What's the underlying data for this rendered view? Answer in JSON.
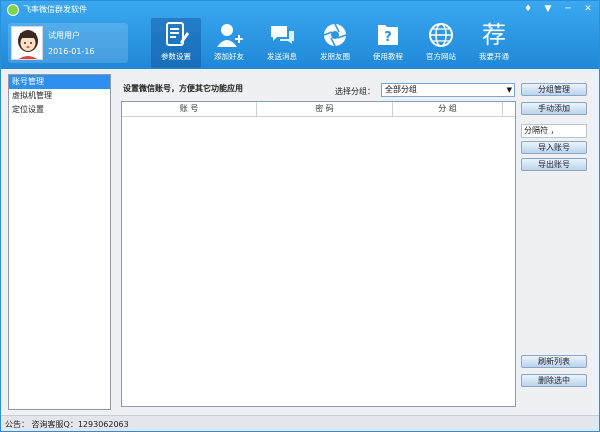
{
  "app": {
    "title": "飞率微信群发软件"
  },
  "window_controls": [
    "♦",
    "▼",
    "─",
    "✕"
  ],
  "user": {
    "name": "试用用户",
    "date": "2016-01-16"
  },
  "nav": [
    {
      "label": "参数设置",
      "icon": "settings-doc-icon"
    },
    {
      "label": "添加好友",
      "icon": "add-user-icon"
    },
    {
      "label": "发送消息",
      "icon": "chat-icon"
    },
    {
      "label": "发朋友圈",
      "icon": "aperture-icon"
    },
    {
      "label": "使用教程",
      "icon": "help-doc-icon"
    },
    {
      "label": "官方网站",
      "icon": "globe-icon"
    },
    {
      "label": "我要开通",
      "icon": "recommend-char-icon",
      "char": "荐"
    }
  ],
  "sidebar": {
    "items": [
      "账号管理",
      "虚拟机管理",
      "定位设置"
    ]
  },
  "main": {
    "heading": "设置微信账号，方便其它功能应用",
    "group_label": "选择分组：",
    "group_value": "全部分组",
    "columns": [
      "账 号",
      "密 码",
      "分 组"
    ]
  },
  "right_panel": {
    "group_manage": "分组管理",
    "manual_add": "手动添加",
    "separator_label": "分隔符 ，",
    "import": "导入账号",
    "export": "导出账号",
    "refresh": "刷新列表",
    "delete": "删除选中"
  },
  "status": {
    "text": "公告：  咨询客服Q：1293062063"
  },
  "colors": {
    "header": "#2b97e4",
    "accent": "#2d8ff0"
  }
}
